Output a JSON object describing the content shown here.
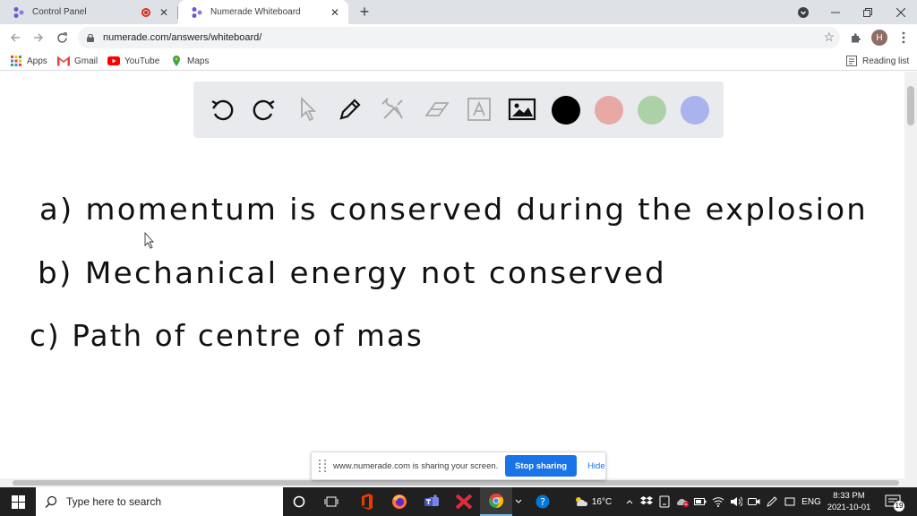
{
  "browser": {
    "tabs": [
      {
        "title": "Control Panel",
        "recording": true
      },
      {
        "title": "Numerade Whiteboard",
        "active": true
      }
    ],
    "address": "numerade.com/answers/whiteboard/",
    "profile_initial": "H",
    "bookmarks": [
      {
        "label": "Apps",
        "icon": "apps-grid-icon"
      },
      {
        "label": "Gmail",
        "icon": "gmail-icon"
      },
      {
        "label": "YouTube",
        "icon": "youtube-icon"
      },
      {
        "label": "Maps",
        "icon": "maps-icon"
      }
    ],
    "reading_list": "Reading list"
  },
  "whiteboard": {
    "tools": [
      "undo-icon",
      "redo-icon",
      "pointer-icon",
      "pen-icon",
      "tools-icon",
      "eraser-icon",
      "text-icon",
      "image-icon"
    ],
    "colors": {
      "black": "#000000",
      "red": "#e8a8a5",
      "green": "#acd1a7",
      "blue": "#aab3ee"
    },
    "handwriting": [
      "a) momentum is conserved during the explosion",
      "b) Mechanical energy not conserved",
      "c) Path of centre of mas"
    ]
  },
  "share_banner": {
    "message": "www.numerade.com is sharing your screen.",
    "stop_label": "Stop sharing",
    "hide_label": "Hide"
  },
  "taskbar": {
    "search_placeholder": "Type here to search",
    "weather": "16°C",
    "language": "ENG",
    "time": "8:33 PM",
    "date": "2021-10-01",
    "notification_count": "19"
  }
}
